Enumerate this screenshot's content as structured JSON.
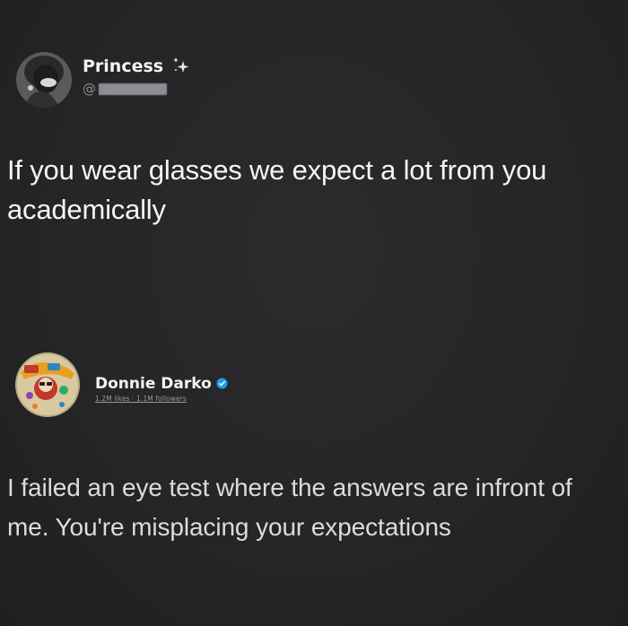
{
  "post1": {
    "display_name": "Princess",
    "handle_prefix": "@",
    "body": "If you wear glasses we expect a lot from you academically",
    "icons": {
      "avatar": "avatar-photo",
      "badge": "sparkle-icon"
    }
  },
  "post2": {
    "display_name": "Donnie Darko",
    "stats": "1.2M likes · 1.1M followers",
    "body": "I failed an eye test where the answers are infront of me. You're misplacing your expectations",
    "icons": {
      "avatar": "avatar-cartoon",
      "badge": "verified-icon"
    }
  },
  "colors": {
    "background": "#262628",
    "text_primary": "#f5f5f5",
    "text_secondary": "#dcdcdc",
    "verified_blue": "#1d9bf0"
  }
}
